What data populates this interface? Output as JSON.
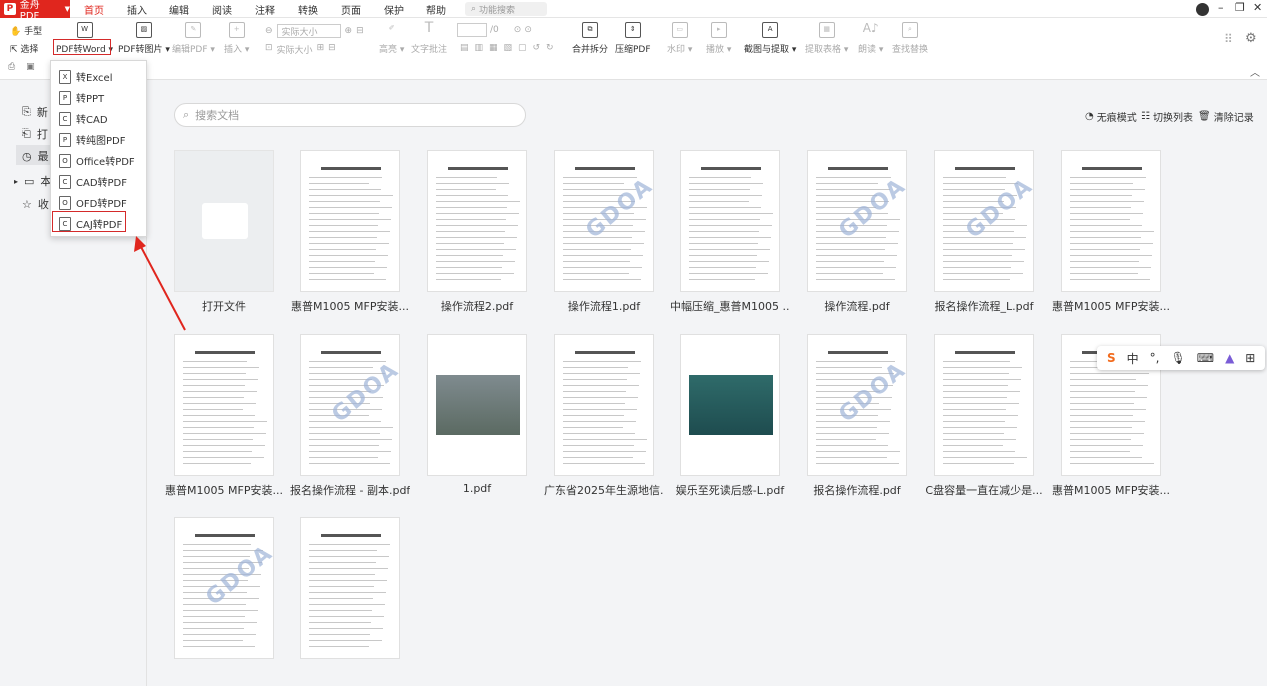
{
  "titlebar": {
    "app_name": "金舟PDF",
    "tabs": [
      "首页",
      "插入",
      "编辑",
      "阅读",
      "注释",
      "转换",
      "页面",
      "保护",
      "帮助"
    ],
    "active_tab": "首页",
    "search_placeholder": "功能搜索"
  },
  "toolbar": {
    "hand": "手型",
    "select": "选择",
    "pdf_to_word": "PDF转Word",
    "pdf_to_image": "PDF转图片",
    "edit_pdf": "编辑PDF",
    "insert": "插入",
    "actual_size_field": "实际大小",
    "actual_size": "实际大小",
    "highlight": "高亮",
    "text_note": "文字批注",
    "merge_split": "合并拆分",
    "compress_pdf": "压缩PDF",
    "watermark": "水印",
    "play": "播放",
    "screenshot_extract": "截图与提取",
    "extract_table": "提取表格",
    "read_aloud": "朗读",
    "find_replace": "查找替换",
    "page_box": "/0"
  },
  "dropdown": {
    "items": [
      "转Excel",
      "转PPT",
      "转CAD",
      "转纯图PDF",
      "Office转PDF",
      "CAD转PDF",
      "OFD转PDF",
      "CAJ转PDF"
    ],
    "icons": [
      "X",
      "P",
      "C",
      "P",
      "O",
      "C",
      "O",
      "C"
    ]
  },
  "sidebar": {
    "items": [
      "新",
      "打",
      "最",
      "本",
      "收"
    ]
  },
  "main": {
    "search_placeholder": "搜索文档",
    "right_tools": [
      "无痕模式",
      "切换列表",
      "清除记录"
    ],
    "files": [
      "打开文件",
      "惠普M1005 MFP安装...",
      "操作流程2.pdf",
      "操作流程1.pdf",
      "中幅压缩_惠普M1005 ...",
      "操作流程.pdf",
      "报名操作流程_L.pdf",
      "惠普M1005 MFP安装...",
      "惠普M1005 MFP安装...",
      "报名操作流程 - 副本.pdf",
      "1.pdf",
      "广东省2025年生源地信...",
      "娱乐至死读后感-L.pdf",
      "报名操作流程.pdf",
      "C盘容量一直在减少是...",
      "惠普M1005 MFP安装...",
      "",
      ""
    ]
  },
  "ime": {
    "logo": "S",
    "lang": "中"
  }
}
